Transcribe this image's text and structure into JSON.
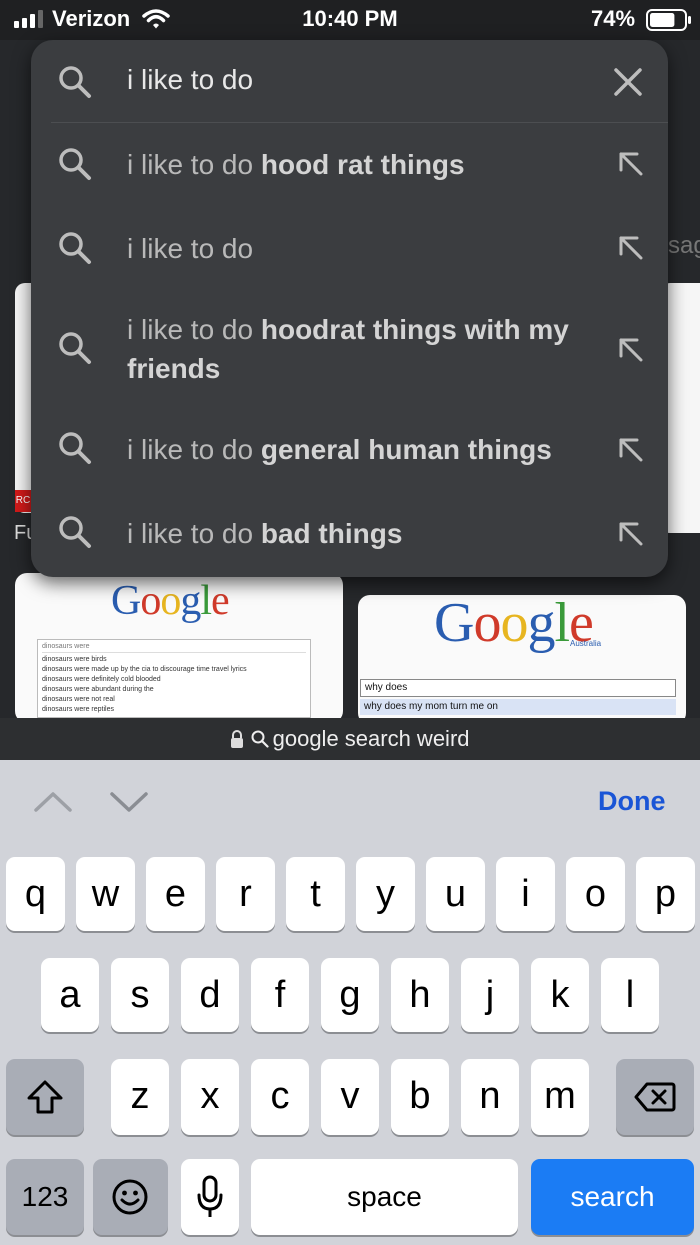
{
  "status_bar": {
    "carrier": "Verizon",
    "time": "10:40 PM",
    "battery_percent": "74%",
    "battery_level": 0.74
  },
  "background": {
    "partial_text_right": "sag",
    "badge_text": "RC",
    "partial_label": "Fu",
    "thumb1": {
      "logo": "Google",
      "query": "dinosaurs were",
      "suggestions": [
        "dinosaurs were birds",
        "dinosaurs were made up by the cia to discourage time travel lyrics",
        "dinosaurs were definitely cold blooded",
        "dinosaurs were abundant during the",
        "dinosaurs were not real",
        "dinosaurs were reptiles"
      ]
    },
    "thumb2": {
      "logo": "Google",
      "region": "Australia",
      "query": "why does",
      "suggestion": "why does my mom turn me on"
    }
  },
  "search": {
    "query": "i like to do",
    "suggestions": [
      {
        "prefix": "i like to do ",
        "bold": "hood rat things"
      },
      {
        "prefix": "i like to do",
        "bold": ""
      },
      {
        "prefix": "i like to do ",
        "bold": "hoodrat things with my friends"
      },
      {
        "prefix": "i like to do ",
        "bold": "general human things"
      },
      {
        "prefix": "i like to do ",
        "bold": "bad things"
      }
    ]
  },
  "url_bar": {
    "text": "google search weird"
  },
  "keyboard": {
    "done_label": "Done",
    "row1": [
      "q",
      "w",
      "e",
      "r",
      "t",
      "y",
      "u",
      "i",
      "o",
      "p"
    ],
    "row2": [
      "a",
      "s",
      "d",
      "f",
      "g",
      "h",
      "j",
      "k",
      "l"
    ],
    "row3": [
      "z",
      "x",
      "c",
      "v",
      "b",
      "n",
      "m"
    ],
    "numbers_label": "123",
    "space_label": "space",
    "search_label": "search",
    "icons": [
      "shift-icon",
      "backspace-icon",
      "emoji-icon",
      "microphone-icon",
      "chevron-up-icon",
      "chevron-down-icon"
    ]
  }
}
